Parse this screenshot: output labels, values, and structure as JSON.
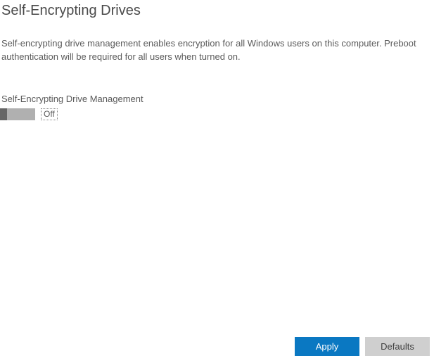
{
  "page": {
    "title": "Self-Encrypting Drives",
    "description": "Self-encrypting drive management enables encryption for all Windows users on this computer. Preboot authentication will be required for all users when turned on."
  },
  "toggle": {
    "label": "Self-Encrypting Drive Management",
    "state": "off",
    "status_text": "Off"
  },
  "footer": {
    "apply_label": "Apply",
    "defaults_label": "Defaults"
  }
}
